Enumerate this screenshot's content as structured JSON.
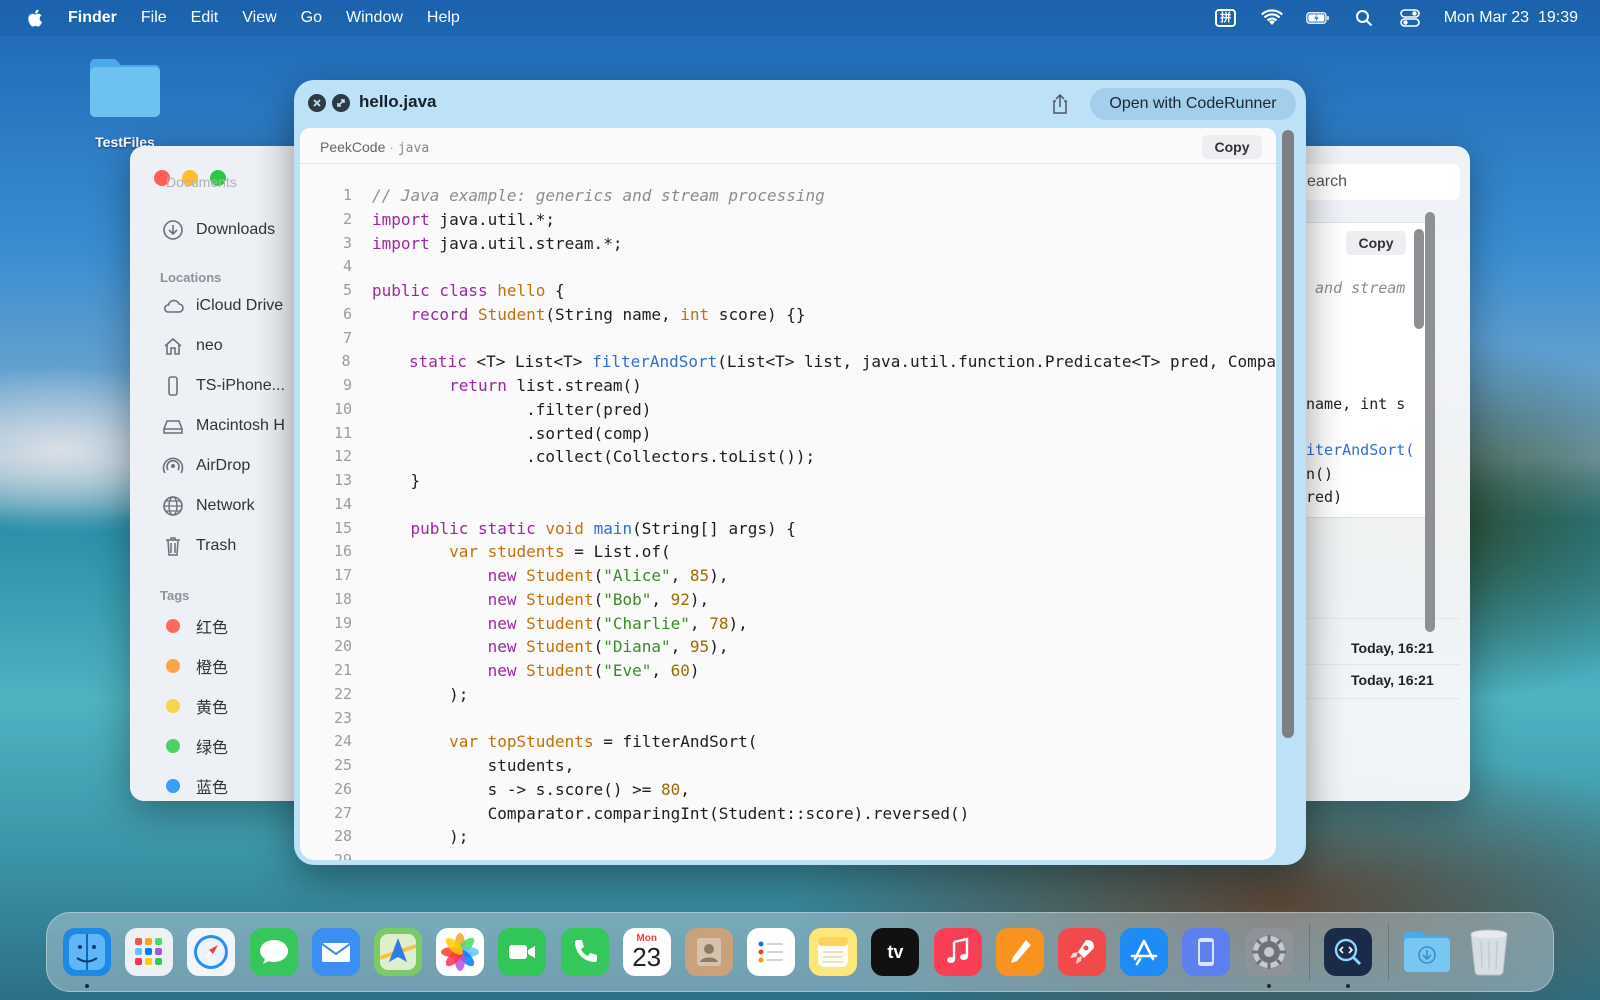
{
  "menubar": {
    "app_name": "Finder",
    "menus": [
      "File",
      "Edit",
      "View",
      "Go",
      "Window",
      "Help"
    ],
    "ime_label": "拼",
    "datetime": "Mon Mar 23  19:39"
  },
  "desktop": {
    "folder_label": "TestFiles"
  },
  "finder": {
    "faded_item": "Documents",
    "sidebar_items": [
      "Downloads"
    ],
    "locations_header": "Locations",
    "locations": [
      "iCloud Drive",
      "neo",
      "TS-iPhone...",
      "Macintosh H",
      "AirDrop",
      "Network",
      "Trash"
    ],
    "tags_header": "Tags",
    "tags": [
      {
        "label": "红色",
        "color": "#fe6a63"
      },
      {
        "label": "橙色",
        "color": "#f8a54a"
      },
      {
        "label": "黄色",
        "color": "#f6d54c"
      },
      {
        "label": "绿色",
        "color": "#4fcf68"
      },
      {
        "label": "蓝色",
        "color": "#3d9cf5"
      }
    ],
    "search_placeholder": "earch",
    "preview_copy": "Copy",
    "preview_lines": [
      " and stream ",
      "",
      "",
      "",
      "",
      "name, int s",
      "",
      "iterAndSort(",
      "n()",
      "red)",
      "   .."
    ],
    "dates": [
      "Today, 16:21",
      "Today, 16:21"
    ]
  },
  "quicklook": {
    "filename": "hello.java",
    "open_with": "Open with CodeRunner",
    "brand": "PeekCode",
    "separator": " · ",
    "language": "java",
    "copy_label": "Copy",
    "lines": [
      [
        [
          "comment",
          "// Java example: generics and stream processing"
        ]
      ],
      [
        [
          "keyword",
          "import"
        ],
        [
          "plain",
          " java.util.*;"
        ]
      ],
      [
        [
          "keyword",
          "import"
        ],
        [
          "plain",
          " java.util.stream.*;"
        ]
      ],
      [],
      [
        [
          "keyword",
          "public class"
        ],
        [
          "plain",
          " "
        ],
        [
          "type",
          "hello"
        ],
        [
          "plain",
          " {"
        ]
      ],
      [
        [
          "plain",
          "    "
        ],
        [
          "keyword",
          "record"
        ],
        [
          "plain",
          " "
        ],
        [
          "type",
          "Student"
        ],
        [
          "plain",
          "(String name, "
        ],
        [
          "type",
          "int"
        ],
        [
          "plain",
          " score) {}"
        ]
      ],
      [],
      [
        [
          "plain",
          "    "
        ],
        [
          "keyword",
          "static"
        ],
        [
          "plain",
          " <T> List<T> "
        ],
        [
          "fn",
          "filterAndSort"
        ],
        [
          "plain",
          "(List<T> list, java.util.function.Predicate<T> pred, Compa"
        ]
      ],
      [
        [
          "plain",
          "        "
        ],
        [
          "keyword",
          "return"
        ],
        [
          "plain",
          " list.stream()"
        ]
      ],
      [
        [
          "plain",
          "                .filter(pred)"
        ]
      ],
      [
        [
          "plain",
          "                .sorted(comp)"
        ]
      ],
      [
        [
          "plain",
          "                .collect(Collectors.toList());"
        ]
      ],
      [
        [
          "plain",
          "    }"
        ]
      ],
      [],
      [
        [
          "plain",
          "    "
        ],
        [
          "keyword",
          "public static"
        ],
        [
          "plain",
          " "
        ],
        [
          "type",
          "void"
        ],
        [
          "plain",
          " "
        ],
        [
          "fn",
          "main"
        ],
        [
          "plain",
          "(String[] args) {"
        ]
      ],
      [
        [
          "plain",
          "        "
        ],
        [
          "type",
          "var"
        ],
        [
          "plain",
          " "
        ],
        [
          "type",
          "students"
        ],
        [
          "plain",
          " = List.of("
        ]
      ],
      [
        [
          "plain",
          "            "
        ],
        [
          "keyword",
          "new"
        ],
        [
          "plain",
          " "
        ],
        [
          "type",
          "Student"
        ],
        [
          "plain",
          "("
        ],
        [
          "string",
          "\"Alice\""
        ],
        [
          "plain",
          ", "
        ],
        [
          "number",
          "85"
        ],
        [
          "plain",
          "),"
        ]
      ],
      [
        [
          "plain",
          "            "
        ],
        [
          "keyword",
          "new"
        ],
        [
          "plain",
          " "
        ],
        [
          "type",
          "Student"
        ],
        [
          "plain",
          "("
        ],
        [
          "string",
          "\"Bob\""
        ],
        [
          "plain",
          ", "
        ],
        [
          "number",
          "92"
        ],
        [
          "plain",
          "),"
        ]
      ],
      [
        [
          "plain",
          "            "
        ],
        [
          "keyword",
          "new"
        ],
        [
          "plain",
          " "
        ],
        [
          "type",
          "Student"
        ],
        [
          "plain",
          "("
        ],
        [
          "string",
          "\"Charlie\""
        ],
        [
          "plain",
          ", "
        ],
        [
          "number",
          "78"
        ],
        [
          "plain",
          "),"
        ]
      ],
      [
        [
          "plain",
          "            "
        ],
        [
          "keyword",
          "new"
        ],
        [
          "plain",
          " "
        ],
        [
          "type",
          "Student"
        ],
        [
          "plain",
          "("
        ],
        [
          "string",
          "\"Diana\""
        ],
        [
          "plain",
          ", "
        ],
        [
          "number",
          "95"
        ],
        [
          "plain",
          "),"
        ]
      ],
      [
        [
          "plain",
          "            "
        ],
        [
          "keyword",
          "new"
        ],
        [
          "plain",
          " "
        ],
        [
          "type",
          "Student"
        ],
        [
          "plain",
          "("
        ],
        [
          "string",
          "\"Eve\""
        ],
        [
          "plain",
          ", "
        ],
        [
          "number",
          "60"
        ],
        [
          "plain",
          ")"
        ]
      ],
      [
        [
          "plain",
          "        );"
        ]
      ],
      [],
      [
        [
          "plain",
          "        "
        ],
        [
          "type",
          "var"
        ],
        [
          "plain",
          " "
        ],
        [
          "type",
          "topStudents"
        ],
        [
          "plain",
          " = filterAndSort("
        ]
      ],
      [
        [
          "plain",
          "            students,"
        ]
      ],
      [
        [
          "plain",
          "            s -> s.score() >= "
        ],
        [
          "number",
          "80"
        ],
        [
          "plain",
          ","
        ]
      ],
      [
        [
          "plain",
          "            Comparator.comparingInt(Student::score).reversed()"
        ]
      ],
      [
        [
          "plain",
          "        );"
        ]
      ]
    ]
  },
  "dock": {
    "apps": [
      {
        "name": "finder",
        "bg": "#1e88e5",
        "running": true
      },
      {
        "name": "launchpad",
        "bg": "#eef1f4",
        "running": false
      },
      {
        "name": "safari",
        "bg": "#f2f6fa",
        "running": false
      },
      {
        "name": "messages",
        "bg": "#35c759",
        "running": false
      },
      {
        "name": "mail",
        "bg": "#3b8ff2",
        "running": false
      },
      {
        "name": "maps",
        "bg": "#7cc968",
        "running": false
      },
      {
        "name": "photos",
        "bg": "#ffffff",
        "running": false
      },
      {
        "name": "facetime",
        "bg": "#32c55a",
        "running": false
      },
      {
        "name": "phone",
        "bg": "#34c759",
        "running": false
      },
      {
        "name": "calendar",
        "bg": "#ffffff",
        "running": false
      },
      {
        "name": "contacts",
        "bg": "#c8a27a",
        "running": false
      },
      {
        "name": "reminders",
        "bg": "#ffffff",
        "running": false
      },
      {
        "name": "notes",
        "bg": "#fde77a",
        "running": false
      },
      {
        "name": "tv",
        "bg": "#111111",
        "running": false
      },
      {
        "name": "music",
        "bg": "#fa3e55",
        "running": false
      },
      {
        "name": "pages",
        "bg": "#f7931e",
        "running": false
      },
      {
        "name": "rocket",
        "bg": "#f24a4a",
        "running": false
      },
      {
        "name": "app-store",
        "bg": "#1e8cf6",
        "running": false
      },
      {
        "name": "simulator",
        "bg": "#5d7ff0",
        "running": false
      },
      {
        "name": "system-settings",
        "bg": "#8e9399",
        "running": true
      }
    ],
    "peekcode_bg": "#1a2b4a",
    "calendar_month": "Mon",
    "calendar_day": "23",
    "tv_label": "tv"
  }
}
